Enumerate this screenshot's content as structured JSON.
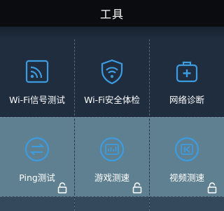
{
  "header": {
    "title": "工具"
  },
  "tools": {
    "row1": [
      {
        "label": "Wi-Fi信号测试",
        "icon": "wifi-signal-icon"
      },
      {
        "label": "Wi-Fi安全体检",
        "icon": "wifi-shield-icon"
      },
      {
        "label": "网络诊断",
        "icon": "first-aid-kit-icon"
      }
    ],
    "row2": [
      {
        "label": "Ping测试",
        "icon": "ping-arrows-icon",
        "locked": true
      },
      {
        "label": "游戏测速",
        "icon": "game-speed-icon",
        "locked": true
      },
      {
        "label": "视频测速",
        "icon": "video-speed-icon",
        "locked": true
      }
    ]
  },
  "colors": {
    "header_bg": "#0b0c10",
    "page_bg": "#1f2d3e",
    "locked_row_bg": "#5f8090",
    "icon_accent": "#3d9be0"
  }
}
